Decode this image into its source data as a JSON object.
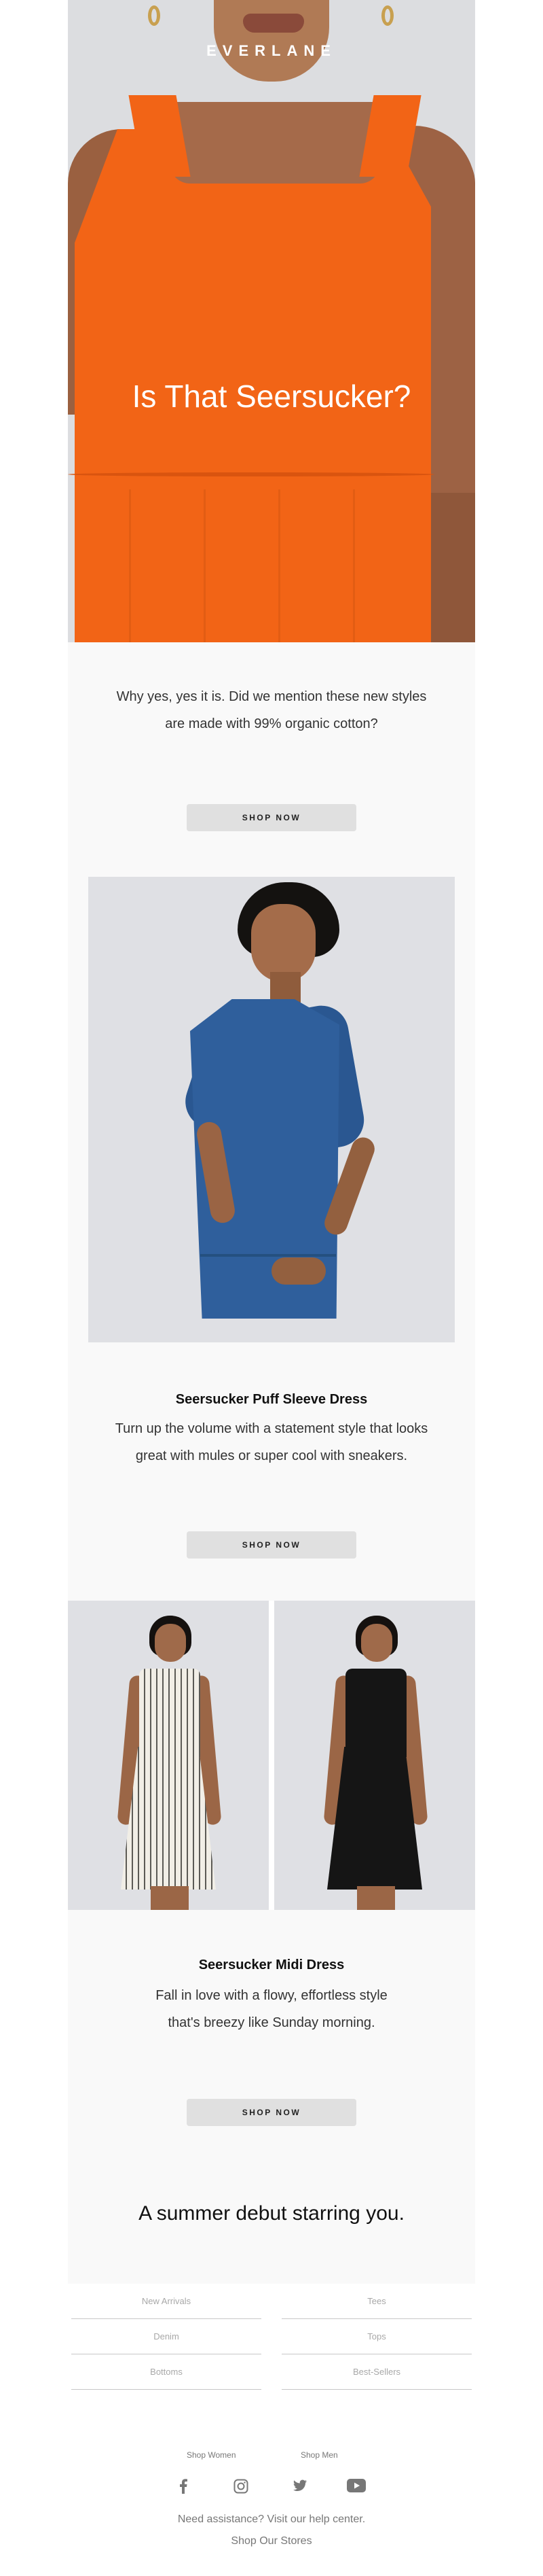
{
  "brand": {
    "logo": "EVERLANE"
  },
  "hero": {
    "headline": "Is That Seersucker?"
  },
  "intro": {
    "line1": "Why yes, yes it is. Did we mention these new styles",
    "line2": "are made with 99% organic cotton?"
  },
  "buttons": {
    "shop_now": "SHOP NOW"
  },
  "product1": {
    "title": "Seersucker Puff Sleeve Dress",
    "desc_line1": "Turn up the volume with a statement style that looks",
    "desc_line2": "great with mules or super cool with sneakers."
  },
  "product2": {
    "title": "Seersucker Midi Dress",
    "desc_line1": "Fall in love with a flowy, effortless style",
    "desc_line2": "that's breezy like Sunday morning."
  },
  "closer": "A summer debut starring you.",
  "footer": {
    "nav": [
      {
        "label": "New Arrivals"
      },
      {
        "label": "Tees"
      },
      {
        "label": "Denim"
      },
      {
        "label": "Tops"
      },
      {
        "label": "Bottoms"
      },
      {
        "label": "Best-Sellers"
      }
    ],
    "shop_women": "Shop Women",
    "shop_men": "Shop Men",
    "social": [
      "facebook-icon",
      "instagram-icon",
      "twitter-icon",
      "youtube-icon"
    ],
    "help": "Need assistance? Visit our help center.",
    "stores": "Shop Our Stores"
  },
  "colors": {
    "hero_dress": "#f26416",
    "puff_dress": "#2f5f9c",
    "button_bg": "#e0e0e0",
    "page_bg": "#f9f9f9"
  }
}
